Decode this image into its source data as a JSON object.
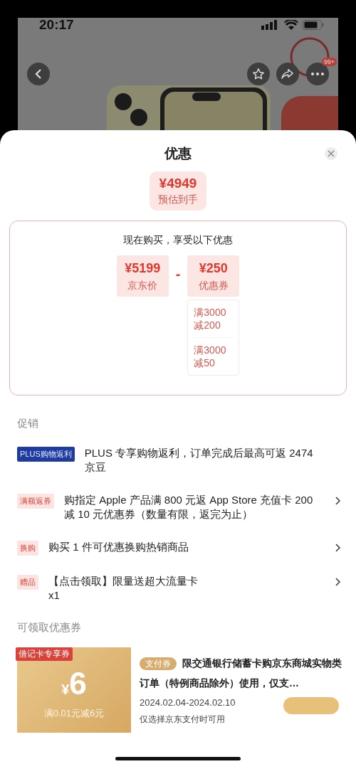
{
  "status_bar": {
    "time": "20:17"
  },
  "product_header": {
    "badge": "99+"
  },
  "sheet": {
    "title": "优惠",
    "estimate": {
      "price": "¥4949",
      "label": "预估到手"
    },
    "breakdown": {
      "heading": "现在购买，享受以下优惠",
      "operator": "-",
      "items": [
        {
          "price": "¥5199",
          "label": "京东价"
        },
        {
          "price": "¥250",
          "label": "优惠券"
        }
      ],
      "coupon_details": [
        "满3000减200",
        "满3000减50"
      ]
    },
    "promotions": {
      "title": "促销",
      "items": [
        {
          "kind": "plus",
          "tag": "PLUS购物返利",
          "text": "PLUS 专享购物返利，订单完成后最高可返 2474 京豆",
          "has_arrow": false
        },
        {
          "kind": "normal",
          "tag": "满额返券",
          "text": "购指定 Apple 产品满 800 元返 App Store 充值卡 200 减 10 元优惠券（数量有限，返完为止）",
          "has_arrow": true
        },
        {
          "kind": "normal",
          "tag": "换购",
          "text": "购买 1 件可优惠换购热销商品",
          "has_arrow": true
        },
        {
          "kind": "normal",
          "tag": "赠品",
          "text": "【点击领取】限量送超大流量卡",
          "quantity": "x1",
          "has_arrow": true
        }
      ]
    },
    "coupons": {
      "title": "可领取优惠券",
      "items": [
        {
          "ribbon": "借记卡专享券",
          "currency": "¥",
          "amount": "6",
          "condition": "满0.01元减6元",
          "type_tag": "支付券",
          "title": "限交通银行储蓄卡购京东商城实物类订单（特例商品除外）使用，仅支…",
          "dates": "2024.02.04-2024.02.10",
          "note": "仅选择京东支付时可用"
        }
      ]
    }
  }
}
